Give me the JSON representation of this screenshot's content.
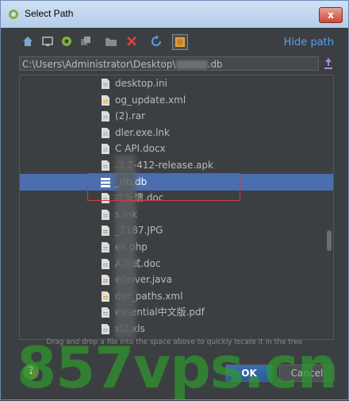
{
  "window": {
    "title": "Select Path",
    "close_label": "x"
  },
  "toolbar": {
    "hide_path": "Hide path"
  },
  "path": {
    "prefix": "C:\\Users\\Administrator\\Desktop\\",
    "suffix": ".db"
  },
  "tree": {
    "rows": [
      {
        "name": "desktop.ini",
        "icon": "file-icon"
      },
      {
        "name": "og_update.xml",
        "icon": "xml-file-icon"
      },
      {
        "name": "(2).rar",
        "icon": "archive-icon"
      },
      {
        "name": "dler.exe.lnk",
        "icon": "shortcut-icon"
      },
      {
        "name": "C API.docx",
        "icon": "document-icon"
      },
      {
        "name": ".3.2-412-release.apk",
        "icon": "apk-icon"
      },
      {
        "name": "_db.db",
        "icon": "database-icon",
        "selected": true
      },
      {
        "name": "弌反馈.doc",
        "icon": "document-icon"
      },
      {
        "name": "s.lnk",
        "icon": "shortcut-icon"
      },
      {
        "name": "_2187.JPG",
        "icon": "image-icon"
      },
      {
        "name": "ex.php",
        "icon": "php-file-icon"
      },
      {
        "name": "A测试.doc",
        "icon": "document-icon"
      },
      {
        "name": "eceiver.java",
        "icon": "java-file-icon"
      },
      {
        "name": "der_paths.xml",
        "icon": "xml-file-icon"
      },
      {
        "name": "essential中文版.pdf",
        "icon": "pdf-icon"
      },
      {
        "name": "si2.xls",
        "icon": "spreadsheet-icon"
      }
    ]
  },
  "hint": "Drag and drop a file into the space above to quickly locate it in the tree",
  "buttons": {
    "help": "?",
    "ok": "OK",
    "cancel": "Cancel"
  },
  "watermark": "857vps.cn",
  "colors": {
    "selection": "#4b6eaf",
    "link": "#589df6",
    "annotation": "#d03a3a"
  }
}
